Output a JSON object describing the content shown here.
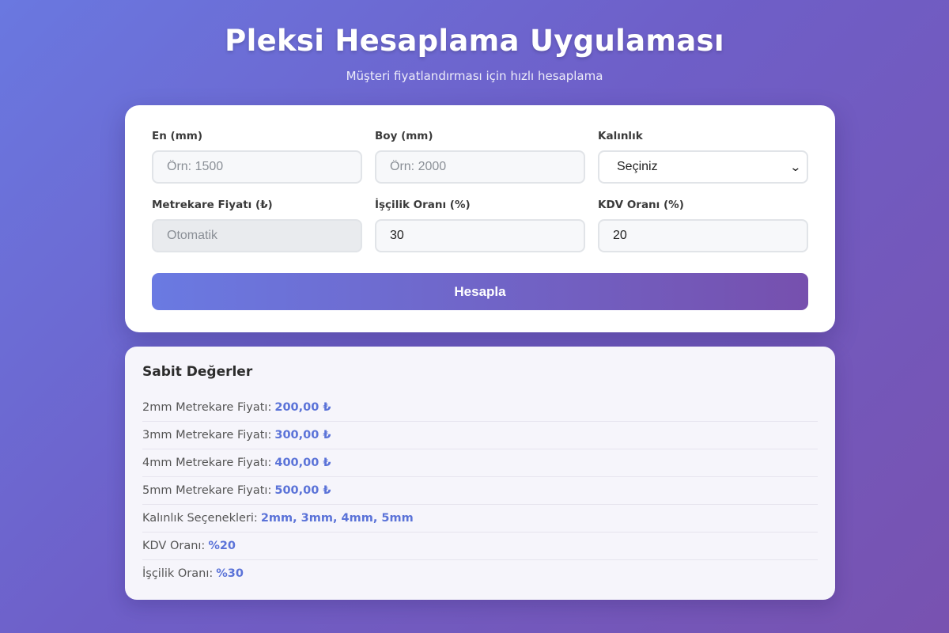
{
  "header": {
    "title": "Pleksi Hesaplama Uygulaması",
    "subtitle": "Müşteri fiyatlandırması için hızlı hesaplama"
  },
  "form": {
    "width": {
      "label": "En (mm)",
      "placeholder": "Örn: 1500",
      "value": ""
    },
    "height": {
      "label": "Boy (mm)",
      "placeholder": "Örn: 2000",
      "value": ""
    },
    "thickness": {
      "label": "Kalınlık",
      "selected": "Seçiniz"
    },
    "sqm_price": {
      "label": "Metrekare Fiyatı (₺)",
      "placeholder": "Otomatik",
      "value": ""
    },
    "labor_rate": {
      "label": "İşçilik Oranı (%)",
      "value": "30"
    },
    "vat_rate": {
      "label": "KDV Oranı (%)",
      "value": "20"
    },
    "submit_label": "Hesapla"
  },
  "constants": {
    "title": "Sabit Değerler",
    "rows": [
      {
        "label": "2mm Metrekare Fiyatı:",
        "value": "200,00 ₺"
      },
      {
        "label": "3mm Metrekare Fiyatı:",
        "value": "300,00 ₺"
      },
      {
        "label": "4mm Metrekare Fiyatı:",
        "value": "400,00 ₺"
      },
      {
        "label": "5mm Metrekare Fiyatı:",
        "value": "500,00 ₺"
      },
      {
        "label": "Kalınlık Seçenekleri:",
        "value": "2mm, 3mm, 4mm, 5mm"
      },
      {
        "label": "KDV Oranı:",
        "value": "%20"
      },
      {
        "label": "İşçilik Oranı:",
        "value": "%30"
      }
    ]
  },
  "colors": {
    "accent": "#5b73d8",
    "gradient_start": "#6a7ae2",
    "gradient_end": "#7650ae"
  }
}
